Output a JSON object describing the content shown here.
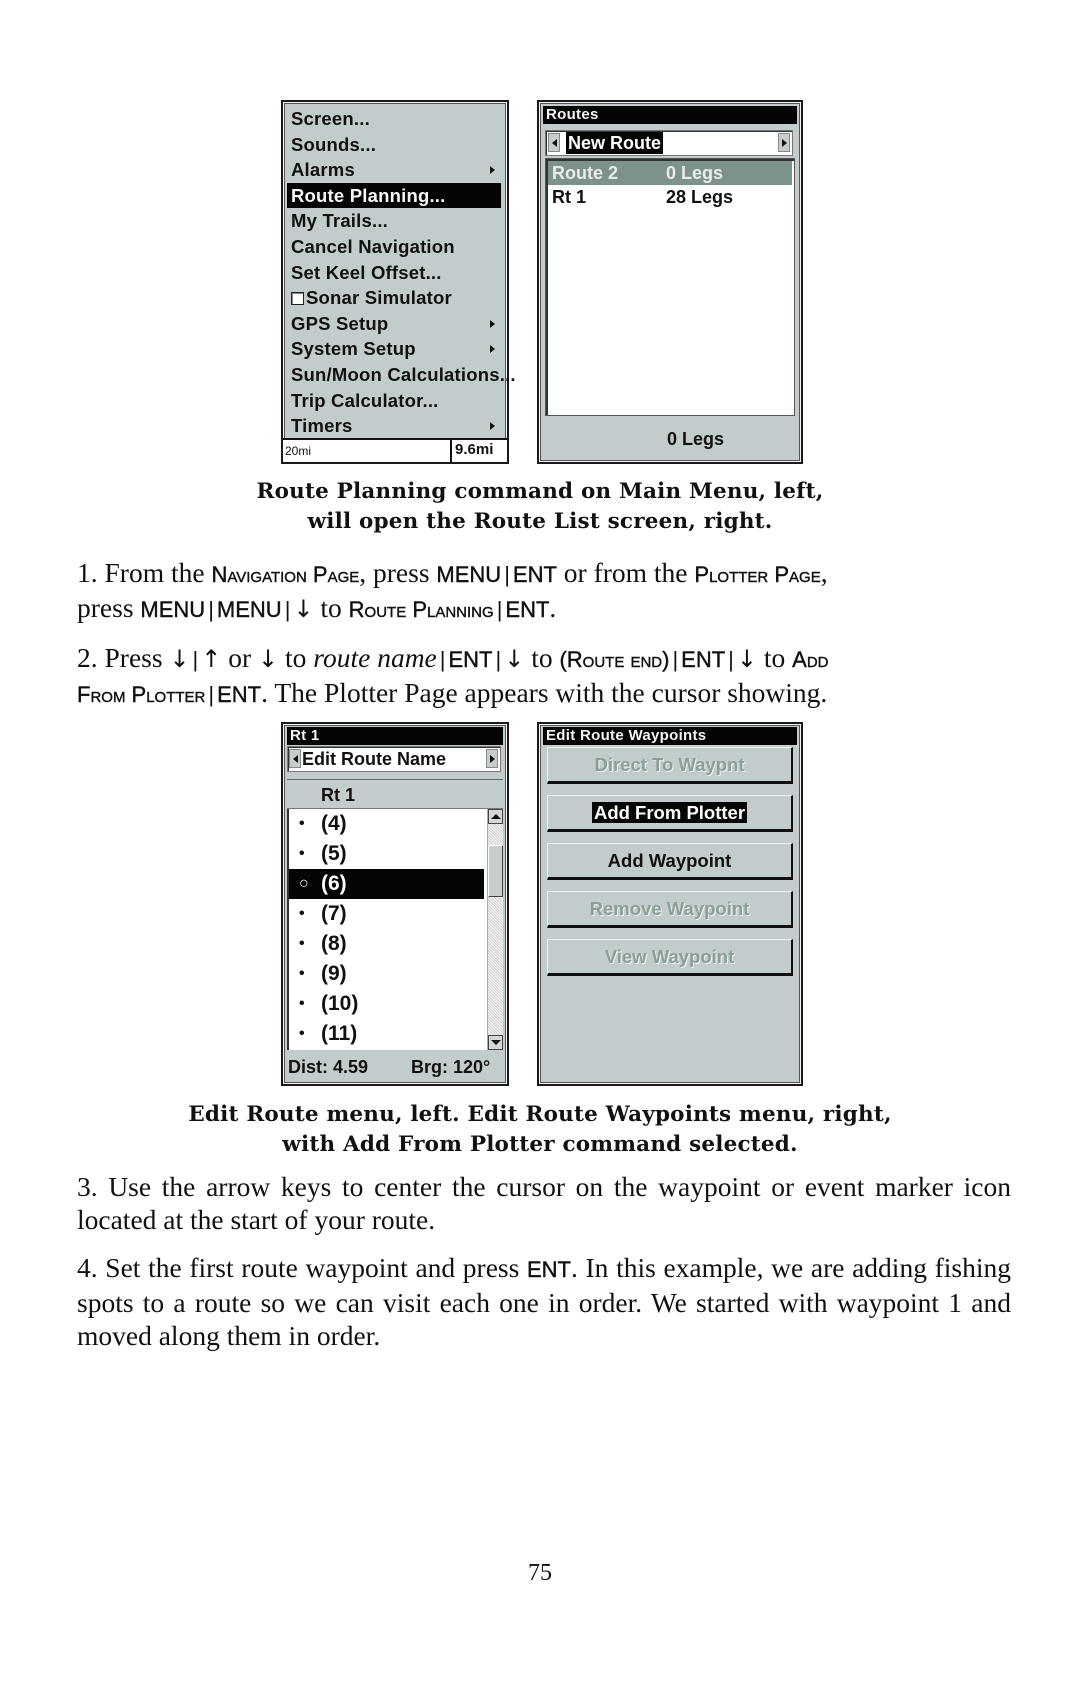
{
  "figure1": {
    "main_menu": {
      "items": [
        {
          "label": "Screen...",
          "submenu": false,
          "selected": false
        },
        {
          "label": "Sounds...",
          "submenu": false,
          "selected": false
        },
        {
          "label": "Alarms",
          "submenu": true,
          "selected": false
        },
        {
          "label": "Route Planning...",
          "submenu": false,
          "selected": true
        },
        {
          "label": "My Trails...",
          "submenu": false,
          "selected": false
        },
        {
          "label": "Cancel Navigation",
          "submenu": false,
          "selected": false
        },
        {
          "label": "Set Keel Offset...",
          "submenu": false,
          "selected": false
        },
        {
          "label": "Sonar Simulator",
          "submenu": false,
          "selected": false,
          "checkbox": true,
          "checked": false
        },
        {
          "label": "GPS Setup",
          "submenu": true,
          "selected": false
        },
        {
          "label": "System Setup",
          "submenu": true,
          "selected": false
        },
        {
          "label": "Sun/Moon Calculations...",
          "submenu": false,
          "selected": false
        },
        {
          "label": "Trip Calculator...",
          "submenu": false,
          "selected": false
        },
        {
          "label": "Timers",
          "submenu": true,
          "selected": false
        }
      ],
      "scale_left": "20mi",
      "scale_right": "9.6mi"
    },
    "routes_screen": {
      "title": "Routes",
      "selector_value": "New Route",
      "routes": [
        {
          "name": "Route 2",
          "legs": "0 Legs",
          "selected": true
        },
        {
          "name": "Rt 1",
          "legs": "28 Legs",
          "selected": false
        }
      ],
      "footer": "0 Legs"
    },
    "caption_line1": "Route Planning command on Main Menu, left,",
    "caption_line2": "will open the Route List screen, right."
  },
  "step1": {
    "t1": "1. From the ",
    "navigation_page": "Navigation Page",
    "t2": ", press ",
    "menu": "MENU",
    "ent": "ENT",
    "t3": " or from the ",
    "plotter_page": "Plotter Page",
    "t4": ",",
    "t5": "press ",
    "menu2": "MENU",
    "menu3": "MENU",
    "down_arrow": "↓",
    "t6": " to ",
    "route_planning": "Route Planning",
    "ent2": "ENT",
    "t7": "."
  },
  "step2": {
    "t1": "2. Press ",
    "down_arrow": "↓",
    "up_arrow": "↑",
    "t_or": " or ",
    "t_to": " to ",
    "route_name": "route name",
    "ent": "ENT",
    "route_end": "(Route end)",
    "add_from_plotter": "Add From Plotter",
    "add_word": "Add",
    "from_plotter_word": "From Plotter",
    "t_end": ". The Plotter Page appears with the cursor showing."
  },
  "figure2": {
    "edit_route": {
      "title": "Rt 1",
      "selector_value": "Edit Route Name",
      "route_header": "Rt 1",
      "waypoints": [
        {
          "label": "(4)",
          "selected": false
        },
        {
          "label": "(5)",
          "selected": false
        },
        {
          "label": "(6)",
          "selected": true
        },
        {
          "label": "(7)",
          "selected": false
        },
        {
          "label": "(8)",
          "selected": false
        },
        {
          "label": "(9)",
          "selected": false
        },
        {
          "label": "(10)",
          "selected": false
        },
        {
          "label": "(11)",
          "selected": false
        }
      ],
      "bullet": "•",
      "bullet_selected": "○",
      "dist": "Dist: 4.59",
      "brg": "Brg: 120°"
    },
    "edit_waypoints": {
      "title": "Edit Route Waypoints",
      "buttons": [
        {
          "label": "Direct To Waypnt",
          "enabled": false,
          "selected": false
        },
        {
          "label": "Add From Plotter",
          "enabled": true,
          "selected": true
        },
        {
          "label": "Add Waypoint",
          "enabled": true,
          "selected": false
        },
        {
          "label": "Remove Waypoint",
          "enabled": false,
          "selected": false
        },
        {
          "label": "View Waypoint",
          "enabled": false,
          "selected": false
        }
      ]
    },
    "caption_line1": "Edit Route menu, left. Edit Route Waypoints menu, right,",
    "caption_line2": "with Add From Plotter command selected."
  },
  "step3": {
    "text": "3. Use the arrow keys to center the cursor on the waypoint or event marker icon located at the start of your route."
  },
  "step4": {
    "t1": "4. Set the first route waypoint and press ",
    "ent": "ENT",
    "t2": ". In this example, we are adding fishing spots to a route so we can visit each one in order. We started with waypoint 1 and moved along them in order."
  },
  "page_number": "75",
  "colors": {
    "screen_bg": "#c3cccc",
    "highlight_dark": "#050505",
    "route_selected_bg": "#7d928a",
    "disabled_text": "#8aa097"
  }
}
